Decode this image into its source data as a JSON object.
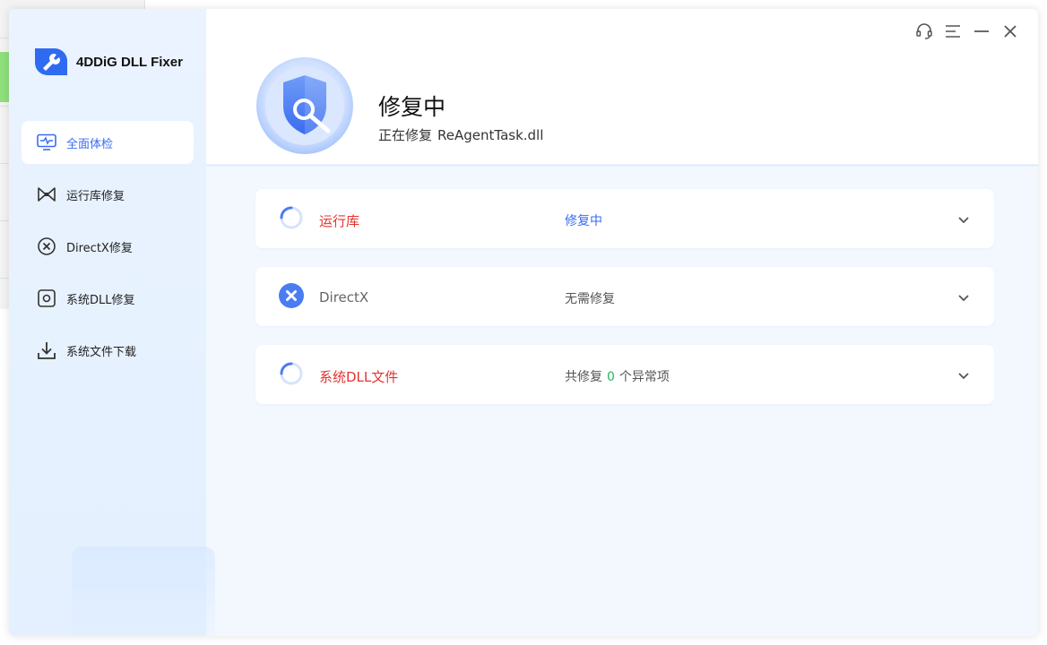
{
  "app": {
    "name": "4DDiG DLL Fixer",
    "accent": "#3a6cf0"
  },
  "sidebar": {
    "items": [
      {
        "label": "全面体检",
        "icon": "monitor-pulse-icon",
        "active": true
      },
      {
        "label": "运行库修复",
        "icon": "bowtie-icon",
        "active": false
      },
      {
        "label": "DirectX修复",
        "icon": "x-circle-icon",
        "active": false
      },
      {
        "label": "系统DLL修复",
        "icon": "chip-icon",
        "active": false
      },
      {
        "label": "系统文件下载",
        "icon": "download-icon",
        "active": false
      }
    ]
  },
  "header": {
    "title": "修复中",
    "subtitle_prefix": "正在修复",
    "file": "ReAgentTask.dll",
    "controls": [
      "headset-icon",
      "menu-icon",
      "minimize-icon",
      "close-icon"
    ]
  },
  "cards": [
    {
      "name": "运行库",
      "status": "修复中",
      "icon": "spinner-icon"
    },
    {
      "name": "DirectX",
      "status": "无需修复",
      "icon": "x-circle-icon"
    },
    {
      "name": "系统DLL文件",
      "status_prefix": "共修复",
      "count": "0",
      "status_suffix": "个异常项",
      "icon": "spinner-icon"
    }
  ],
  "colors": {
    "error_red": "#e3342f",
    "success_green": "#27b45a"
  }
}
